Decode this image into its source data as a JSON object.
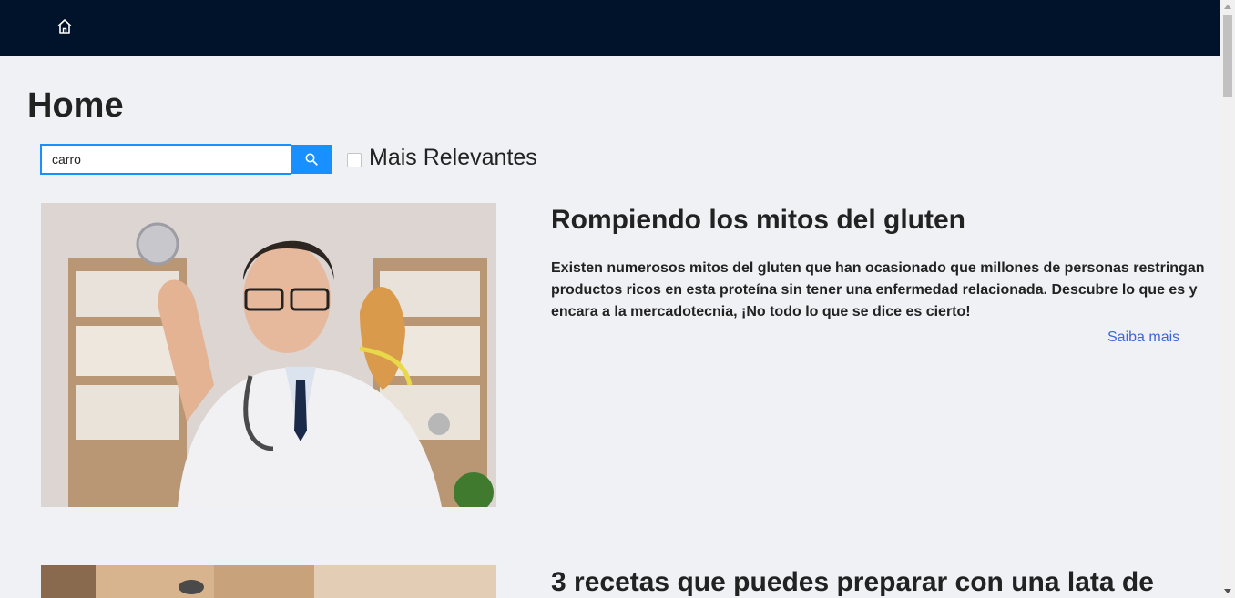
{
  "nav": {
    "home_icon": "home-icon"
  },
  "page": {
    "title": "Home"
  },
  "search": {
    "value": "carro",
    "icon": "search-icon"
  },
  "filter": {
    "label": "Mais Relevantes",
    "checked": false
  },
  "articles": [
    {
      "title": "Rompiendo los mitos del gluten",
      "description": "Existen numerosos mitos del gluten que han ocasionado que millones de personas restringan productos ricos en esta proteína sin tener una enfermedad relacionada. Descubre lo que es y encara a la mercadotecnia, ¡No todo lo que se dice es cierto!",
      "link": "Saiba mais"
    },
    {
      "title": "3 recetas que puedes preparar con una lata de"
    }
  ],
  "colors": {
    "navbar": "#00132b",
    "accent": "#1890ff",
    "link": "#3a68d8",
    "background": "#f0f1f5"
  }
}
